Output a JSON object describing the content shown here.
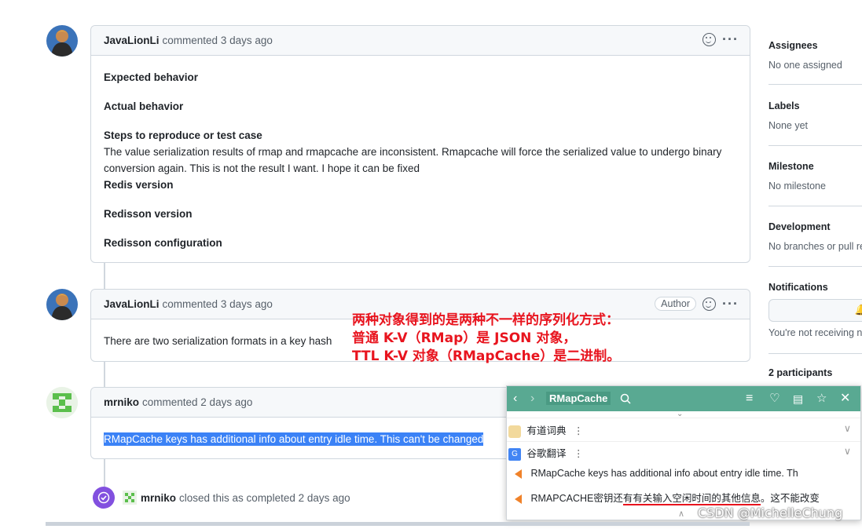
{
  "comments": [
    {
      "author": "JavaLionLi",
      "meta": "commented 3 days ago",
      "body": {
        "expected": "Expected behavior",
        "actual": "Actual behavior",
        "steps_title": "Steps to reproduce or test case",
        "steps_text": "The value serialization results of rmap and rmapcache are inconsistent. Rmapcache will force the serialized value to undergo binary conversion again. This is not the result I want. I hope it can be fixed",
        "redis_version": "Redis version",
        "redisson_version": "Redisson version",
        "redisson_config": "Redisson configuration"
      }
    },
    {
      "author": "JavaLionLi",
      "meta": "commented 3 days ago",
      "badge": "Author",
      "body": "There are two serialization formats in a key hash"
    },
    {
      "author": "mrniko",
      "meta": "commented 2 days ago",
      "body": "RMapCache keys has additional info about entry idle time. This can't be changed"
    }
  ],
  "closed_event": {
    "author": "mrniko",
    "text": "closed this as completed 2 days ago"
  },
  "annotation": {
    "line1": "两种对象得到的是两种不一样的序列化方式：",
    "line2": "普通 K-V（RMap）是 JSON 对象，",
    "line3": "TTL K-V 对象（RMapCache）是二进制。"
  },
  "sidebar": {
    "assignees_title": "Assignees",
    "assignees_value": "No one assigned",
    "labels_title": "Labels",
    "labels_value": "None yet",
    "milestone_title": "Milestone",
    "milestone_value": "No milestone",
    "development_title": "Development",
    "development_value": "No branches or pull re",
    "notifications_title": "Notifications",
    "notifications_value": "You're not receiving no",
    "participants_title": "2 participants"
  },
  "popup": {
    "title": "RMapCache",
    "dict1": "有道词典",
    "dict2": "谷歌翻译",
    "source": "RMapCache keys has additional info about entry idle time. Th",
    "translation_a": "RMAPCACHE密钥还",
    "translation_b": "有有关输入空闲时间的其他信息",
    "translation_c": "。这不能改变"
  },
  "watermark": "CSDN @MichelleChung",
  "colors": {
    "accent_blue": "#3b82f6",
    "annotation_red": "#e8141e",
    "popup_green": "#59a992",
    "closed_purple": "#8250df"
  }
}
